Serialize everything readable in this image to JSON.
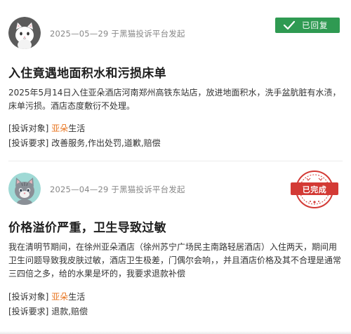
{
  "complaints": [
    {
      "meta": "2025—05—29 于黑猫投诉平台发起",
      "status": "已回复",
      "title": "入住竟遇地面积水和污损床单",
      "body": "2025年5月14日入住亚朵酒店河南郑州高铁东站店，放进地面积水，洗手盆肮脏有水渍，床单污损。酒店态度敷衍不处理。",
      "target_label": "[投诉对象]",
      "target_accent": "亚朵",
      "target_rest": "生活",
      "demand_label": "[投诉要求]",
      "demand_value": "改善服务,作出处罚,道歉,赔偿"
    },
    {
      "meta": "2025—04—29 于黑猫投诉平台发起",
      "status": "已完成",
      "title": "价格溢价严重，卫生导致过敏",
      "body": "我在清明节期间，在徐州亚朵酒店（徐州苏宁广场民主南路轻居酒店）入住两天，期间用卫生问题导致我皮肤过敏，酒店卫生极差，门偶尔会响，，并且酒店价格及其不合理是通常三四倍之多，给的水果是坏的，我要求退款补偿",
      "target_label": "[投诉对象]",
      "target_accent": "亚朵",
      "target_rest": "生活",
      "demand_label": "[投诉要求]",
      "demand_value": "退款,赔偿"
    }
  ],
  "colors": {
    "replied_badge": "#2f9a52",
    "completed_stamp": "#d33a35",
    "accent": "#e8731c"
  },
  "icons": {
    "avatar_1": "cat-avatar-icon",
    "avatar_2": "gray-cat-avatar-icon",
    "check": "check-icon",
    "stamp": "completed-stamp-icon"
  }
}
